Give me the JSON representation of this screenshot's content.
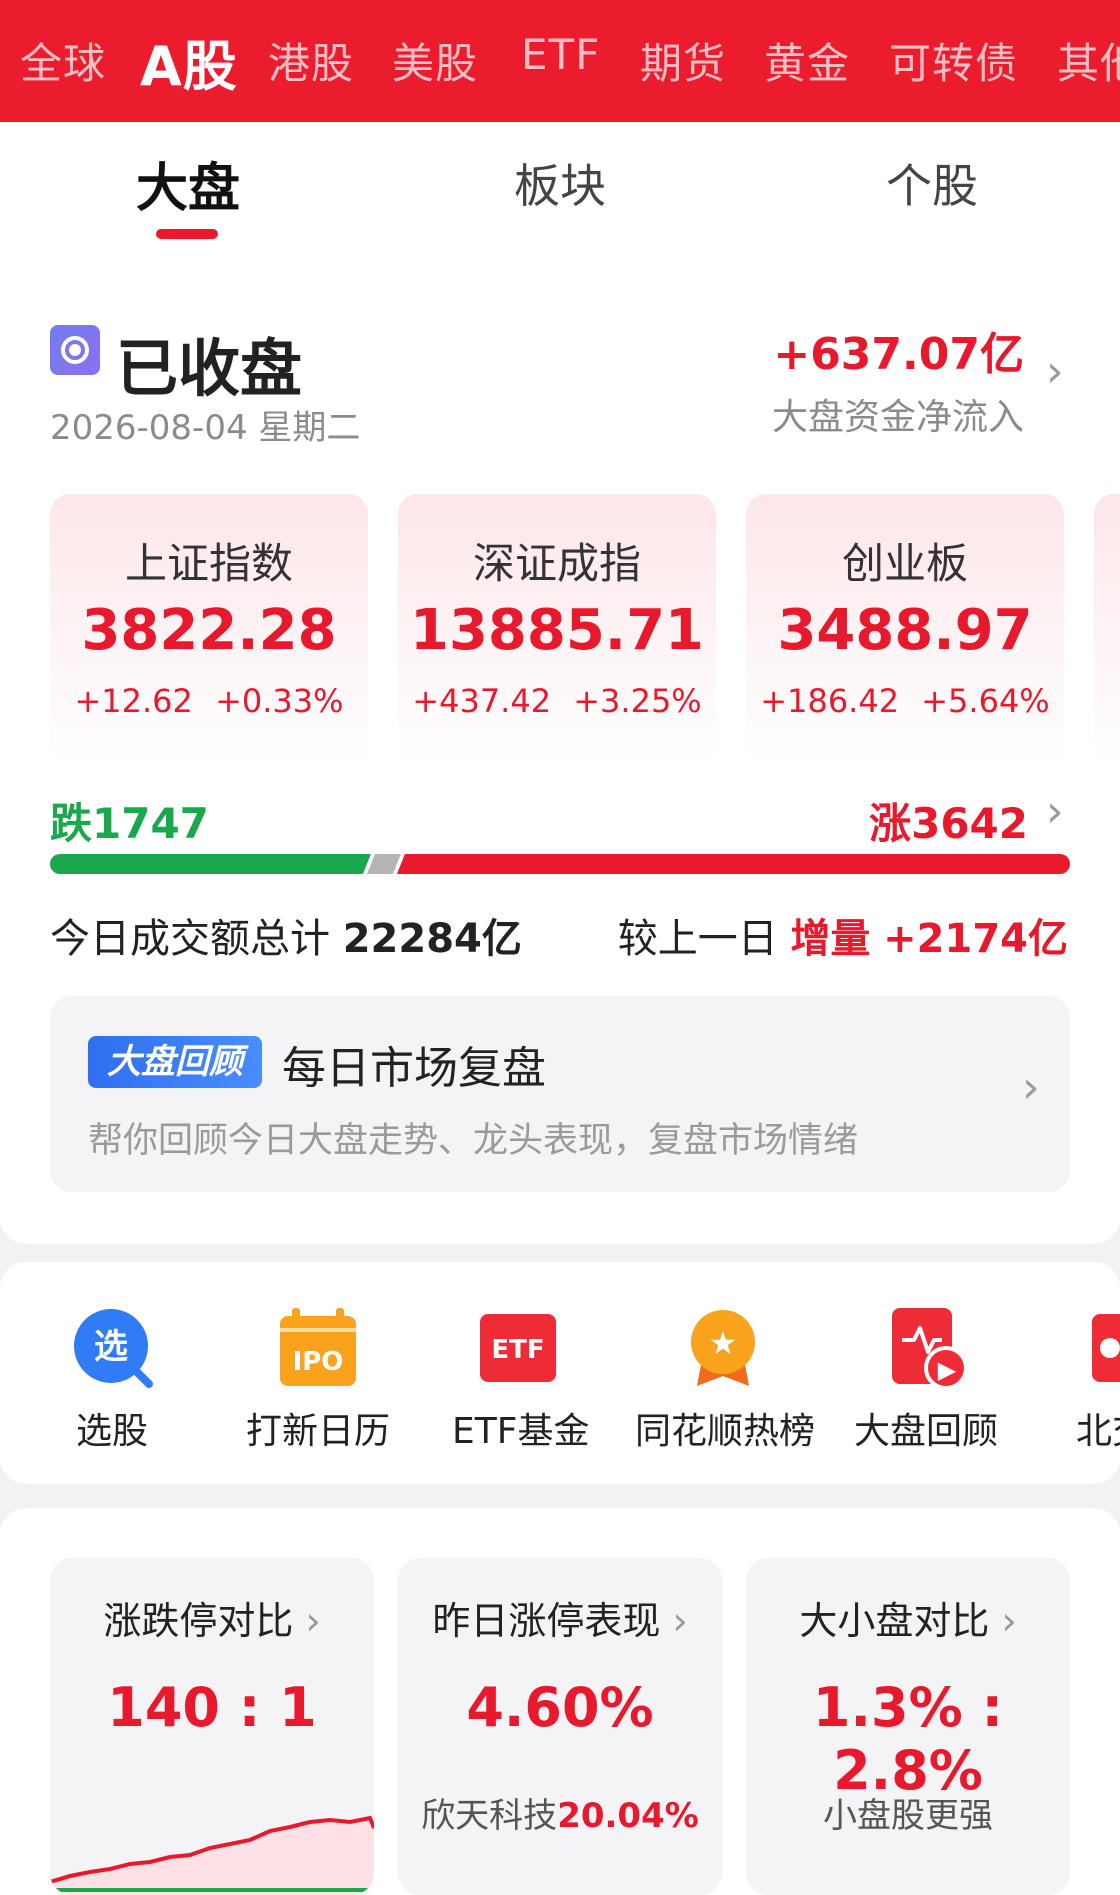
{
  "market_tabs": [
    "全球",
    "A股",
    "港股",
    "美股",
    "ETF",
    "期货",
    "黄金",
    "可转债",
    "其他"
  ],
  "sub_tabs": [
    "大盘",
    "板块",
    "个股"
  ],
  "status": {
    "title": "已收盘",
    "date": "2026-08-04 星期二",
    "net_inflow": "+637.07亿",
    "net_inflow_label": "大盘资金净流入"
  },
  "indices": [
    {
      "name": "上证指数",
      "value": "3822.28",
      "change": "+12.62",
      "pct": "+0.33%"
    },
    {
      "name": "深证成指",
      "value": "13885.71",
      "change": "+437.42",
      "pct": "+3.25%"
    },
    {
      "name": "创业板",
      "value": "3488.97",
      "change": "+186.42",
      "pct": "+5.64%"
    }
  ],
  "breadth": {
    "fall_label": "跌1747",
    "rise_label": "涨3642",
    "fall": 1747,
    "rise": 3642
  },
  "turnover": {
    "label": "今日成交额总计",
    "value": "22284亿",
    "compare_label": "较上一日",
    "compare_tag": "增量",
    "compare_value": "+2174亿"
  },
  "review": {
    "badge": "大盘回顾",
    "title": "每日市场复盘",
    "subtitle": "帮你回顾今日大盘走势、龙头表现，复盘市场情绪"
  },
  "shortcuts": [
    {
      "label": "选股",
      "icon": "search-stock-icon",
      "glyph": "选"
    },
    {
      "label": "打新日历",
      "icon": "ipo-calendar-icon",
      "glyph": "IPO"
    },
    {
      "label": "ETF基金",
      "icon": "etf-icon",
      "glyph": "ETF"
    },
    {
      "label": "同花顺热榜",
      "icon": "hot-list-icon",
      "glyph": "★"
    },
    {
      "label": "大盘回顾",
      "icon": "market-review-icon",
      "glyph": "▶"
    },
    {
      "label": "北交所",
      "icon": "bse-icon",
      "glyph": ""
    }
  ],
  "stats": [
    {
      "title": "涨跌停对比",
      "value": "140 : 1",
      "sub": ""
    },
    {
      "title": "昨日涨停表现",
      "value": "4.60%",
      "sub_name": "欣天科技",
      "sub_value": "20.04%"
    },
    {
      "title": "大小盘对比",
      "value": "1.3% : 2.8%",
      "sub": "小盘股更强"
    }
  ],
  "colors": {
    "brand_red": "#eb1c2d",
    "up_red": "#e8192c",
    "down_green": "#1aa84c"
  }
}
